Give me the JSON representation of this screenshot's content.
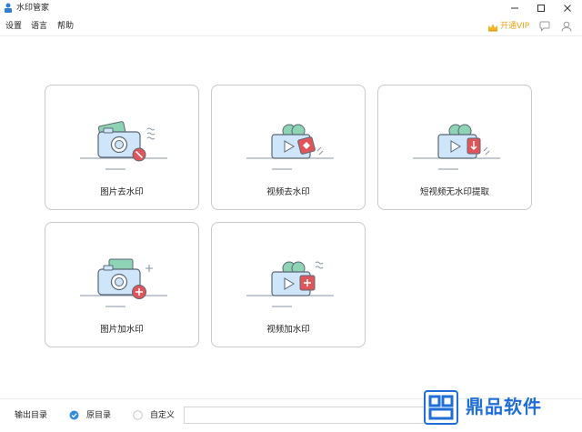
{
  "window": {
    "title": "水印管家"
  },
  "menu": {
    "settings": "设置",
    "language": "语言",
    "help": "帮助"
  },
  "header": {
    "vip_label": "开通VIP"
  },
  "cards": [
    {
      "label": "图片去水印"
    },
    {
      "label": "视频去水印"
    },
    {
      "label": "短视频无水印提取"
    },
    {
      "label": "图片加水印"
    },
    {
      "label": "视频加水印"
    }
  ],
  "footer": {
    "output_dir_label": "输出目录",
    "option_original": "原目录",
    "option_custom": "自定义",
    "selected": "原目录"
  },
  "watermark": {
    "brand_text": "鼎品软件"
  },
  "colors": {
    "accent_blue": "#3b8ad8",
    "accent_red": "#e0555a",
    "vip_gold": "#e8a31a",
    "brand_blue": "#1f6ed8"
  }
}
